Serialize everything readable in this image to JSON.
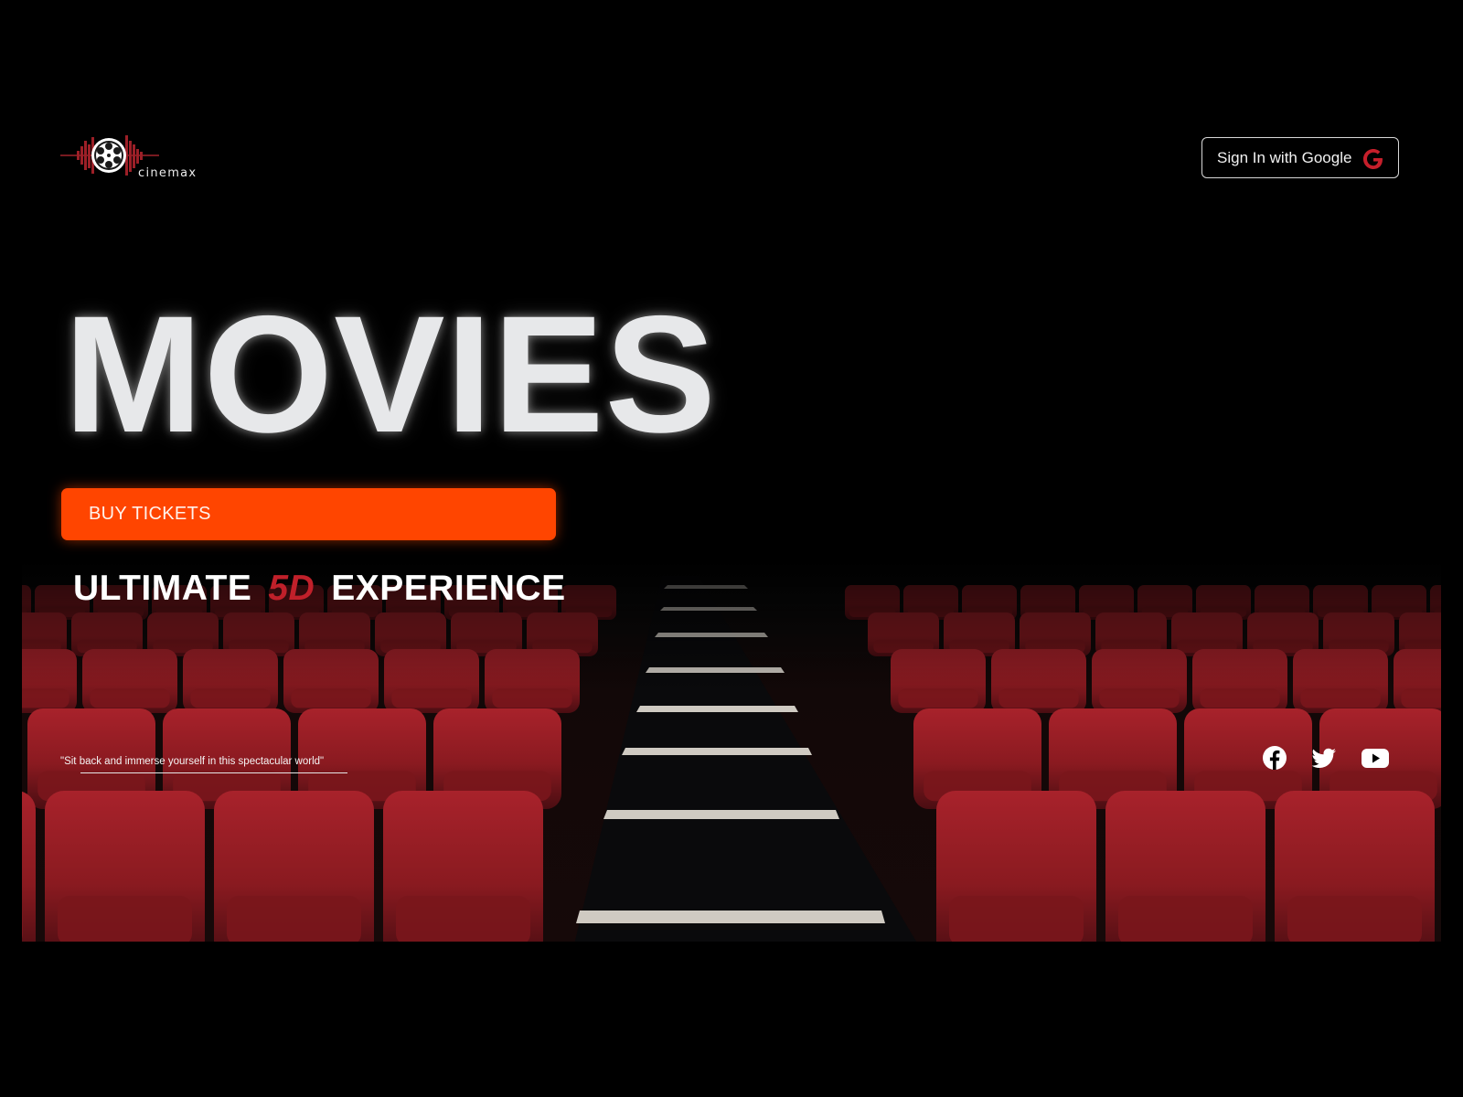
{
  "brand": {
    "name": "cinemax"
  },
  "header": {
    "signin_label": "Sign In with Google",
    "signin_icon": "google-g-icon"
  },
  "hero": {
    "title": "MOVIES",
    "buy_label": "BUY TICKETS",
    "tagline": {
      "prefix": "ULTIMATE",
      "accent": "5D",
      "suffix": "EXPERIENCE"
    },
    "quote": "\"Sit back and immerse yourself in this spectacular world\""
  },
  "socials": [
    {
      "name": "facebook",
      "icon": "facebook-icon"
    },
    {
      "name": "twitter",
      "icon": "twitter-icon"
    },
    {
      "name": "youtube",
      "icon": "youtube-icon"
    }
  ],
  "colors": {
    "background": "#000000",
    "accent_orange": "#ff4500",
    "accent_red": "#c0202a",
    "seat_red": "#8a1a20",
    "title_white": "#e7e8ea"
  }
}
